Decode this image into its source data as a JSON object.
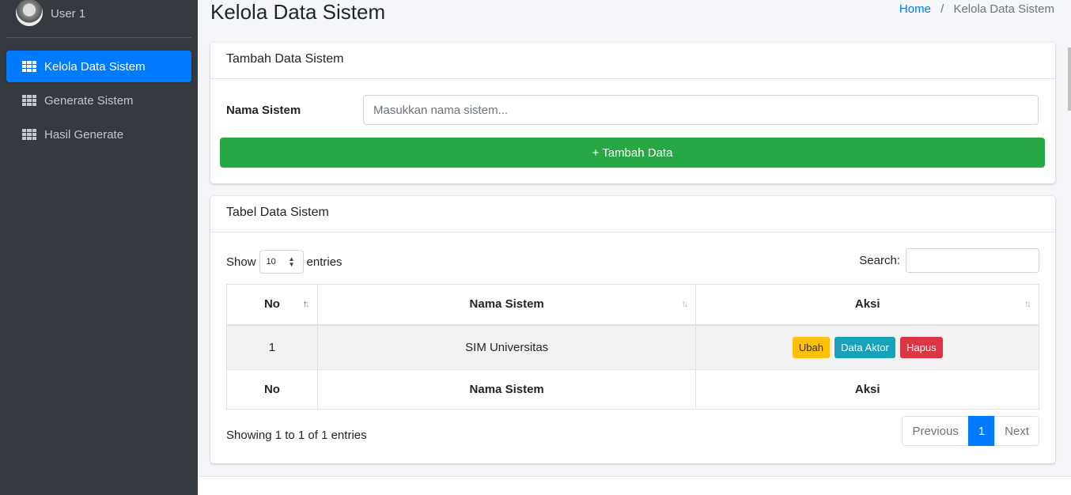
{
  "sidebar": {
    "user_name": "User 1",
    "items": [
      {
        "label": "Kelola Data Sistem",
        "active": true
      },
      {
        "label": "Generate Sistem",
        "active": false
      },
      {
        "label": "Hasil Generate",
        "active": false
      }
    ]
  },
  "header": {
    "title": "Kelola Data Sistem",
    "breadcrumb_home": "Home",
    "breadcrumb_sep": "/",
    "breadcrumb_current": "Kelola Data Sistem"
  },
  "form_card": {
    "title": "Tambah Data Sistem",
    "label": "Nama Sistem",
    "placeholder": "Masukkan nama sistem...",
    "value": "",
    "add_button": "+ Tambah Data"
  },
  "table_card": {
    "title": "Tabel Data Sistem",
    "show_label": "Show",
    "entries_label": "entries",
    "page_length": "10",
    "search_label": "Search:",
    "search_value": "",
    "columns": [
      "No",
      "Nama Sistem",
      "Aksi"
    ],
    "rows": [
      {
        "no": "1",
        "nama": "SIM Universitas"
      }
    ],
    "actions": {
      "edit": "Ubah",
      "actors": "Data Aktor",
      "delete": "Hapus"
    },
    "info": "Showing 1 to 1 of 1 entries",
    "pagination": {
      "previous": "Previous",
      "current": "1",
      "next": "Next"
    }
  },
  "colors": {
    "sidebar_bg": "#343a40",
    "primary": "#007bff",
    "success": "#28a745",
    "warning": "#ffc107",
    "info": "#17a2b8",
    "danger": "#dc3545"
  }
}
